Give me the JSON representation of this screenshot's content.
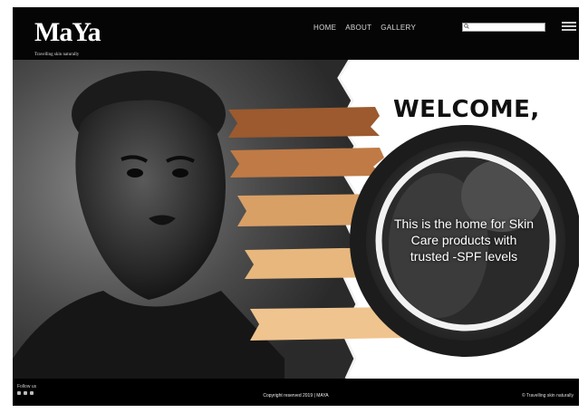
{
  "header": {
    "logo_text": "MaYa",
    "logo_tagline": "Travelling skin naturally",
    "nav": [
      "HOME",
      "ABOUT",
      "GALLERY"
    ],
    "search_placeholder": "",
    "menu_icon": "hamburger-menu-icon"
  },
  "hero": {
    "welcome": "WELCOME,",
    "tagline": "This is the home for Skin Care products with trusted -SPF levels",
    "swatch_colors": [
      "#9c5a2e",
      "#c07a45",
      "#d9a066",
      "#e7b77d",
      "#f0c48f"
    ]
  },
  "footer": {
    "follow_label": "Follow us",
    "copyright": "Copyright reserved 2019 | MAYA",
    "right_text": "© Travelling skin naturally"
  }
}
